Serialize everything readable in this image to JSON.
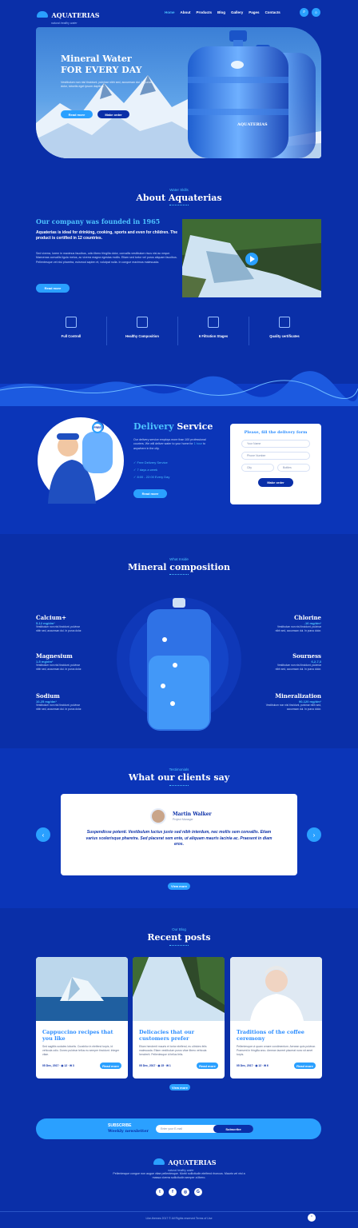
{
  "brand": {
    "name": "AQUATERIAS",
    "tagline": "natural healthy water"
  },
  "nav": {
    "items": [
      "Home",
      "About",
      "Products",
      "Blog",
      "Gallery",
      "Pages",
      "Contacts"
    ],
    "cart_count": "0"
  },
  "hero": {
    "title_line1": "Mineral Water",
    "title_line2": "FOR EVERY DAY",
    "text": "Vestibulum non nisl tincidunt, pulvinar nibh sed, accumsan dui. In purus dolor, lobortis eget ipsum dapibus.",
    "btn_primary": "Read more",
    "btn_secondary": "Make order",
    "bottle_label": "AQUATERIAS"
  },
  "about": {
    "eyebrow": "Water Skills",
    "title": "About Aquaterias",
    "heading": "Our company was founded in 1965",
    "lead": "Aquaterias is ideal for drinking, cooking, sports and even for children. The product is certified in 12 countries.",
    "text": "Sed viverra, lorem in maximus faucibus, odio libero fringilla dolor, convallis vestibulum risus nisi ac neque. Maecenas convallis ligula metus, ac viverra magna egestas mollis. Etiam sed tortor vel purus aliquam faucibus. Pellentesque vel nisi pharetra, euismod sapien et, volutpat nulla. In congue maximus malesuada.",
    "button": "Read more"
  },
  "features": [
    {
      "label": "Full Controll",
      "icon": "microscope-icon"
    },
    {
      "label": "Healthy Composition",
      "icon": "flask-icon"
    },
    {
      "label": "6 Filtration Stages",
      "icon": "filter-icon"
    },
    {
      "label": "Quality certificates",
      "icon": "certificate-icon"
    }
  ],
  "delivery": {
    "title_a": "Delivery",
    "title_b": "Service",
    "badge": "FREE",
    "text": "Our delivery service employs more than 100 professional couriers. We will deliver water to your home for",
    "text_link": "1 hour",
    "text_end": "to anywhere in the city.",
    "list": [
      "Free Delivery Service",
      "7 days a week",
      "8:00 - 22:00 Every Day"
    ],
    "button": "Read more",
    "form": {
      "title": "Please, fill the delivery form",
      "name": "Your Name",
      "phone": "Phone Number",
      "city": "City",
      "bottles": "Bottles",
      "submit": "Make order"
    }
  },
  "composition": {
    "eyebrow": "What Inside",
    "title": "Mineral composition",
    "items": [
      {
        "name": "Calcium+",
        "value": "5-12 mg/dm³",
        "text": "Vestibulum non nisl tincidunt, pulvinar nibh sed, accumsan dui. In purus dolor."
      },
      {
        "name": "Magnesium",
        "value": "1-5 mg/dm³",
        "text": "Vestibulum non nisl tincidunt, pulvinar nibh sed, accumsan dui. In purus dolor."
      },
      {
        "name": "Sodium",
        "value": "10-25 mg/dm³",
        "text": "Vestibulum non nisl tincidunt, pulvinar nibh sed, accumsan dui. In purus dolor."
      },
      {
        "name": "Chlorine",
        "value": "-16 mg/dm³",
        "text": "Vestibulum non nisl tincidunt, pulvinar nibh sed, accumsan dui. In purus dolor."
      },
      {
        "name": "Sourness",
        "value": "6,2-7,3",
        "text": "Vestibulum non nisl tincidunt, pulvinar nibh sed, accumsan dui. In purus dolor."
      },
      {
        "name": "Mineralization",
        "value": "90-120 mg/dm³",
        "text": "Vestibulum non nisl tincidunt, pulvinar nibh sed, accumsan dui. In purus dolor."
      }
    ]
  },
  "testimonials": {
    "eyebrow": "Testimonials",
    "title": "What our clients say",
    "name": "Martin Walker",
    "role": "Project Manager",
    "quote": "Suspendisse potenti. Vestibulum luctus justo sed nibh interdum, nec mollis sem convallis. Etiam varius scelerisque pharetra. Sed placerat sem ente, ut aliquam mauris lacinia ac. Praesent in diam eros.",
    "button": "View more"
  },
  "blog": {
    "eyebrow": "Our Blog",
    "title": "Recent posts",
    "posts": [
      {
        "title": "Cappuccino recipes that you like",
        "text": "Sed sagittis sodales lobortis. Curabitur in eleifend turpis, id vehicula odio. Donec pulvinar tellus eu semper tincidunt. Integer vitae.",
        "date": "05 Dec, 2017",
        "views": "12",
        "comments": "3",
        "button": "Read more"
      },
      {
        "title": "Delicacies that our customers prefer",
        "text": "Etiam hendrerit mauris et tortor eleifend, eu ultricies felis malesuada. Etiam vestibulum purus vitae libero vehicula hendrerit. Pellentesque id tellus felis.",
        "date": "05 Dec, 2017",
        "views": "15",
        "comments": "1",
        "button": "Read more"
      },
      {
        "title": "Traditions of the coffee ceremony",
        "text": "Pellentesque ut quam ornare condimentum. Aenean quis pulvinar. Praesent in fringilla arcu. Aenean laoreet placerat nunc sit amet turpis.",
        "date": "05 Dec, 2017",
        "views": "12",
        "comments": "6",
        "button": "Read more"
      }
    ],
    "button": "View more"
  },
  "newsletter": {
    "title_a": "SUBSCRIBE",
    "title_b": "Weekly newsletter",
    "placeholder": "Enter your E-mail",
    "button": "Subscribe"
  },
  "footer": {
    "text": "Pellentesque congue non augue vitae pellentesque. Morbi sollicitudin eleifend rhoncus. Mauris vel nisl a massa viverra sollicitudin semper a libero.",
    "copyright": "Like-themes 2017 © All Rights reserved Terms of Use",
    "socials": [
      "twitter-icon",
      "facebook-icon",
      "instagram-icon",
      "google-plus-icon"
    ]
  },
  "colors": {
    "bg": "#0a2fa8",
    "accent": "#2aa0ff",
    "light": "#4dc3ff"
  }
}
